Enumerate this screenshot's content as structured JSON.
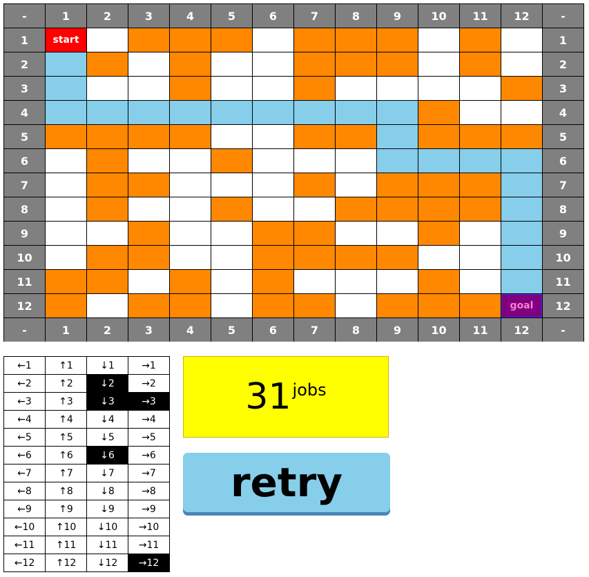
{
  "grid": {
    "header_placeholder": "-",
    "col_labels": [
      "1",
      "2",
      "3",
      "4",
      "5",
      "6",
      "7",
      "8",
      "9",
      "10",
      "11",
      "12"
    ],
    "row_labels": [
      "1",
      "2",
      "3",
      "4",
      "5",
      "6",
      "7",
      "8",
      "9",
      "10",
      "11",
      "12"
    ],
    "start_label": "start",
    "goal_label": "goal",
    "cells": [
      [
        "S",
        "W",
        "O",
        "O",
        "O",
        "W",
        "O",
        "O",
        "O",
        "W",
        "O",
        "W"
      ],
      [
        "B",
        "O",
        "W",
        "O",
        "W",
        "W",
        "O",
        "O",
        "O",
        "W",
        "O",
        "W"
      ],
      [
        "B",
        "W",
        "W",
        "O",
        "W",
        "W",
        "O",
        "W",
        "W",
        "W",
        "W",
        "O"
      ],
      [
        "B",
        "B",
        "B",
        "B",
        "B",
        "B",
        "B",
        "B",
        "B",
        "O",
        "W",
        "W"
      ],
      [
        "O",
        "O",
        "O",
        "O",
        "W",
        "W",
        "O",
        "O",
        "B",
        "O",
        "O",
        "O"
      ],
      [
        "W",
        "O",
        "W",
        "W",
        "O",
        "W",
        "W",
        "W",
        "B",
        "B",
        "B",
        "B"
      ],
      [
        "W",
        "O",
        "O",
        "W",
        "W",
        "W",
        "O",
        "W",
        "O",
        "O",
        "O",
        "B"
      ],
      [
        "W",
        "O",
        "W",
        "W",
        "O",
        "W",
        "W",
        "O",
        "O",
        "O",
        "O",
        "B"
      ],
      [
        "W",
        "W",
        "O",
        "W",
        "W",
        "O",
        "O",
        "W",
        "W",
        "O",
        "W",
        "B"
      ],
      [
        "W",
        "O",
        "O",
        "W",
        "W",
        "O",
        "O",
        "O",
        "O",
        "W",
        "W",
        "B"
      ],
      [
        "O",
        "O",
        "W",
        "O",
        "W",
        "O",
        "W",
        "W",
        "W",
        "O",
        "W",
        "B"
      ],
      [
        "O",
        "W",
        "O",
        "O",
        "W",
        "O",
        "O",
        "W",
        "O",
        "O",
        "O",
        "G"
      ]
    ],
    "colors": {
      "header": "#808080",
      "empty": "#ffffff",
      "obstacle": "#ff8800",
      "path": "#87ceeb",
      "start": "#ff0000",
      "goal": "#800080"
    }
  },
  "moves": {
    "rows": [
      [
        {
          "label": "←1",
          "used": false
        },
        {
          "label": "↑1",
          "used": false
        },
        {
          "label": "↓1",
          "used": false
        },
        {
          "label": "→1",
          "used": false
        }
      ],
      [
        {
          "label": "←2",
          "used": false
        },
        {
          "label": "↑2",
          "used": false
        },
        {
          "label": "↓2",
          "used": true
        },
        {
          "label": "→2",
          "used": false
        }
      ],
      [
        {
          "label": "←3",
          "used": false
        },
        {
          "label": "↑3",
          "used": false
        },
        {
          "label": "↓3",
          "used": true
        },
        {
          "label": "→3",
          "used": true
        }
      ],
      [
        {
          "label": "←4",
          "used": false
        },
        {
          "label": "↑4",
          "used": false
        },
        {
          "label": "↓4",
          "used": false
        },
        {
          "label": "→4",
          "used": false
        }
      ],
      [
        {
          "label": "←5",
          "used": false
        },
        {
          "label": "↑5",
          "used": false
        },
        {
          "label": "↓5",
          "used": false
        },
        {
          "label": "→5",
          "used": false
        }
      ],
      [
        {
          "label": "←6",
          "used": false
        },
        {
          "label": "↑6",
          "used": false
        },
        {
          "label": "↓6",
          "used": true
        },
        {
          "label": "→6",
          "used": false
        }
      ],
      [
        {
          "label": "←7",
          "used": false
        },
        {
          "label": "↑7",
          "used": false
        },
        {
          "label": "↓7",
          "used": false
        },
        {
          "label": "→7",
          "used": false
        }
      ],
      [
        {
          "label": "←8",
          "used": false
        },
        {
          "label": "↑8",
          "used": false
        },
        {
          "label": "↓8",
          "used": false
        },
        {
          "label": "→8",
          "used": false
        }
      ],
      [
        {
          "label": "←9",
          "used": false
        },
        {
          "label": "↑9",
          "used": false
        },
        {
          "label": "↓9",
          "used": false
        },
        {
          "label": "→9",
          "used": false
        }
      ],
      [
        {
          "label": "←10",
          "used": false
        },
        {
          "label": "↑10",
          "used": false
        },
        {
          "label": "↓10",
          "used": false
        },
        {
          "label": "→10",
          "used": false
        }
      ],
      [
        {
          "label": "←11",
          "used": false
        },
        {
          "label": "↑11",
          "used": false
        },
        {
          "label": "↓11",
          "used": false
        },
        {
          "label": "→11",
          "used": false
        }
      ],
      [
        {
          "label": "←12",
          "used": false
        },
        {
          "label": "↑12",
          "used": false
        },
        {
          "label": "↓12",
          "used": false
        },
        {
          "label": "→12",
          "used": true
        }
      ]
    ]
  },
  "jobs": {
    "count": "31",
    "unit": "jobs",
    "color": "#ffff00"
  },
  "retry": {
    "label": "retry",
    "color": "#87ceeb"
  }
}
